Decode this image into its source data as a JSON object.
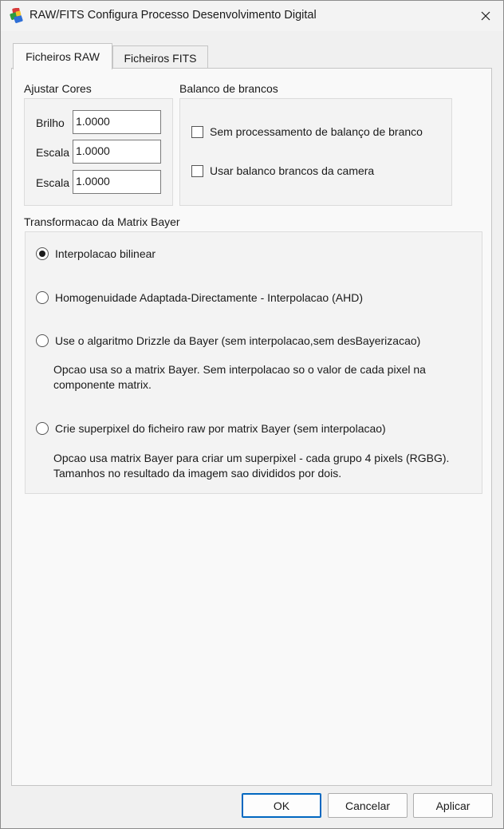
{
  "window": {
    "title": "RAW/FITS Configura Processo Desenvolvimento Digital"
  },
  "tabs": [
    {
      "label": "Ficheiros RAW",
      "active": true
    },
    {
      "label": "Ficheiros FITS",
      "active": false
    }
  ],
  "adjust_colors": {
    "title": "Ajustar Cores",
    "fields": [
      {
        "label": "Brilho",
        "value": "1.0000"
      },
      {
        "label": "Escala",
        "value": "1.0000"
      },
      {
        "label": "Escala",
        "value": "1.0000"
      }
    ]
  },
  "white_balance": {
    "title": "Balanco de brancos",
    "options": [
      {
        "label": "Sem processamento de balanço de branco",
        "checked": false
      },
      {
        "label": "Usar balanco brancos da camera",
        "checked": false
      }
    ]
  },
  "bayer": {
    "title": "Transformacao da Matrix Bayer",
    "options": [
      {
        "label": "Interpolacao bilinear",
        "selected": true
      },
      {
        "label": "Homogenuidade Adaptada-Directamente - Interpolacao (AHD)",
        "selected": false
      },
      {
        "label": "Use o algaritmo Drizzle da Bayer (sem interpolacao,sem desBayerizacao)",
        "selected": false,
        "description": "Opcao usa so a matrix Bayer. Sem interpolacao so o valor de cada pixel na componente matrix."
      },
      {
        "label": "Crie superpixel do ficheiro raw por matrix Bayer (sem interpolacao)",
        "selected": false,
        "description": "Opcao usa matrix Bayer para criar um superpixel - cada grupo 4 pixels (RGBG). Tamanhos no resultado da imagem sao divididos por dois."
      }
    ]
  },
  "buttons": {
    "ok": "OK",
    "cancel": "Cancelar",
    "apply": "Aplicar"
  },
  "icons": {
    "app": "app-icon",
    "close": "close-icon"
  }
}
